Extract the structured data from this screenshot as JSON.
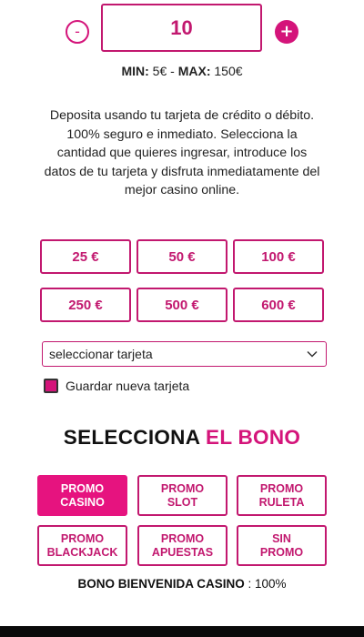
{
  "stepper": {
    "minus": "-",
    "value": "10",
    "plus": "+"
  },
  "limits": {
    "min_label": "MIN:",
    "min_value": "5€",
    "separator": "-",
    "max_label": "MAX:",
    "max_value": "150€"
  },
  "description": "Deposita usando tu tarjeta de crédito o débito. 100% seguro e inmediato. Selecciona la cantidad que quieres ingresar, introduce los datos de tu tarjeta y disfruta inmediatamente del mejor casino online.",
  "amounts": [
    "25 €",
    "50 €",
    "100 €",
    "250 €",
    "500 €",
    "600 €"
  ],
  "card_select": {
    "selected": "seleccionar tarjeta"
  },
  "save_card": {
    "label": "Guardar nueva tarjeta",
    "checked": true
  },
  "bono": {
    "title_part1": "SELECCIONA",
    "title_part2": "EL BONO"
  },
  "promos": [
    {
      "label": "PROMO\nCASINO",
      "active": true
    },
    {
      "label": "PROMO\nSLOT",
      "active": false
    },
    {
      "label": "PROMO\nRULETA",
      "active": false
    },
    {
      "label": "PROMO\nBLACKJACK",
      "active": false
    },
    {
      "label": "PROMO\nAPUESTAS",
      "active": false
    },
    {
      "label": "SIN\nPROMO",
      "active": false
    }
  ],
  "bono_info": {
    "label": "BONO BIENVENIDA CASINO",
    "value": ": 100%"
  },
  "colors": {
    "accent": "#d4147a",
    "accent_active": "#e6137f"
  }
}
